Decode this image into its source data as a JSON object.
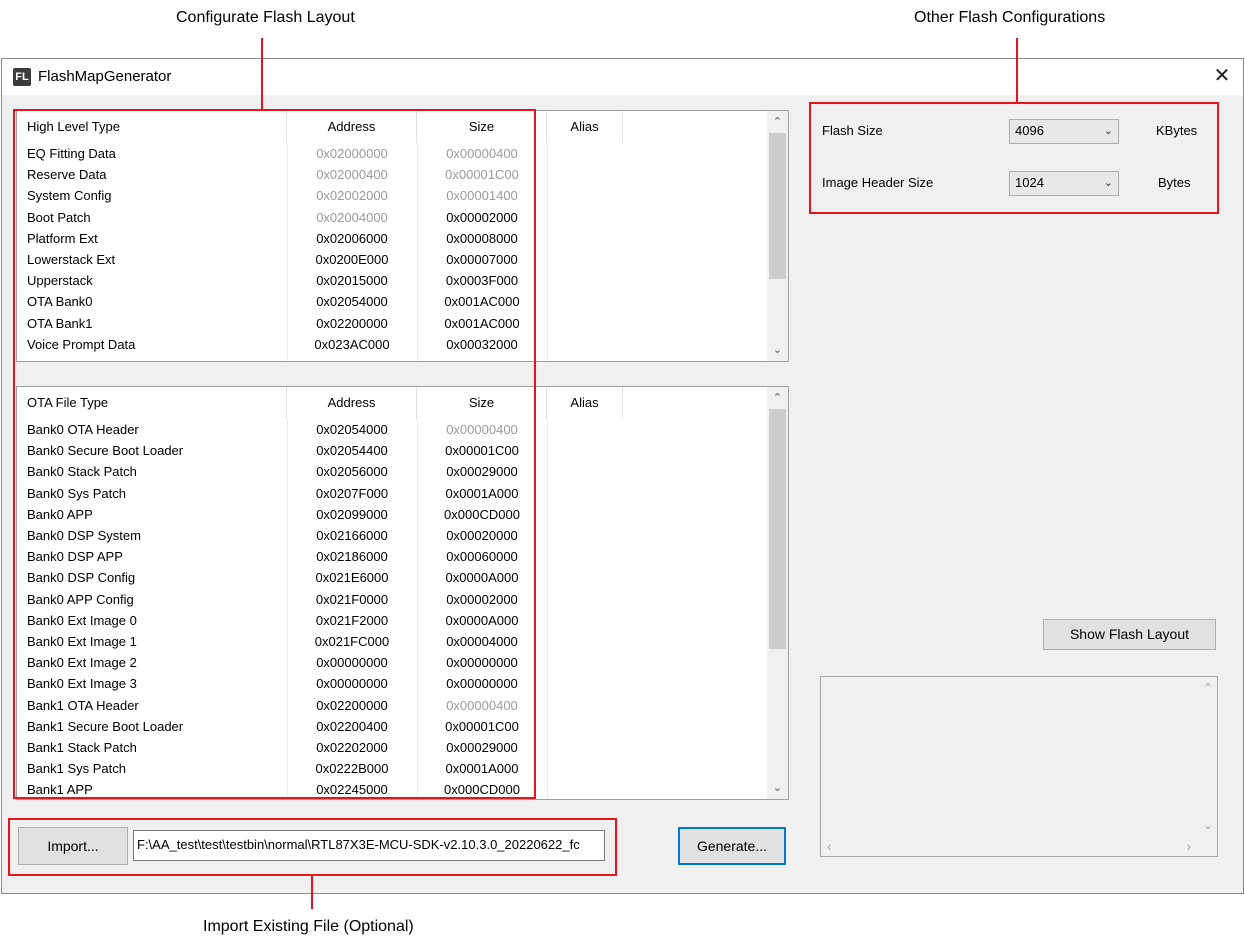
{
  "annotations": {
    "configurate": "Configurate Flash Layout",
    "other": "Other Flash Configurations",
    "import_existing": "Import Existing File (Optional)"
  },
  "window": {
    "title": "FlashMapGenerator",
    "icon_text": "FL",
    "close_glyph": "✕"
  },
  "high_level": {
    "headers": [
      "High Level Type",
      "Address",
      "Size",
      "Alias"
    ],
    "rows": [
      {
        "type": "EQ Fitting Data",
        "address": "0x02000000",
        "size": "0x00000400",
        "addr_gray": true,
        "size_gray": true
      },
      {
        "type": "Reserve Data",
        "address": "0x02000400",
        "size": "0x00001C00",
        "addr_gray": true,
        "size_gray": true
      },
      {
        "type": "System Config",
        "address": "0x02002000",
        "size": "0x00001400",
        "addr_gray": true,
        "size_gray": true
      },
      {
        "type": "Boot Patch",
        "address": "0x02004000",
        "size": "0x00002000",
        "addr_gray": true,
        "size_gray": false
      },
      {
        "type": "Platform Ext",
        "address": "0x02006000",
        "size": "0x00008000",
        "addr_gray": false,
        "size_gray": false
      },
      {
        "type": "Lowerstack Ext",
        "address": "0x0200E000",
        "size": "0x00007000",
        "addr_gray": false,
        "size_gray": false
      },
      {
        "type": "Upperstack",
        "address": "0x02015000",
        "size": "0x0003F000",
        "addr_gray": false,
        "size_gray": false
      },
      {
        "type": "OTA Bank0",
        "address": "0x02054000",
        "size": "0x001AC000",
        "addr_gray": false,
        "size_gray": false
      },
      {
        "type": "OTA Bank1",
        "address": "0x02200000",
        "size": "0x001AC000",
        "addr_gray": false,
        "size_gray": false
      },
      {
        "type": "Voice Prompt Data",
        "address": "0x023AC000",
        "size": "0x00032000",
        "addr_gray": false,
        "size_gray": false
      }
    ]
  },
  "ota_file": {
    "headers": [
      "OTA File Type",
      "Address",
      "Size",
      "Alias"
    ],
    "rows": [
      {
        "type": "Bank0 OTA Header",
        "address": "0x02054000",
        "size": "0x00000400",
        "addr_gray": false,
        "size_gray": true
      },
      {
        "type": "Bank0 Secure Boot Loader",
        "address": "0x02054400",
        "size": "0x00001C00",
        "addr_gray": false,
        "size_gray": false
      },
      {
        "type": "Bank0 Stack Patch",
        "address": "0x02056000",
        "size": "0x00029000",
        "addr_gray": false,
        "size_gray": false
      },
      {
        "type": "Bank0 Sys Patch",
        "address": "0x0207F000",
        "size": "0x0001A000",
        "addr_gray": false,
        "size_gray": false
      },
      {
        "type": "Bank0 APP",
        "address": "0x02099000",
        "size": "0x000CD000",
        "addr_gray": false,
        "size_gray": false
      },
      {
        "type": "Bank0 DSP System",
        "address": "0x02166000",
        "size": "0x00020000",
        "addr_gray": false,
        "size_gray": false
      },
      {
        "type": "Bank0 DSP APP",
        "address": "0x02186000",
        "size": "0x00060000",
        "addr_gray": false,
        "size_gray": false
      },
      {
        "type": "Bank0 DSP Config",
        "address": "0x021E6000",
        "size": "0x0000A000",
        "addr_gray": false,
        "size_gray": false
      },
      {
        "type": "Bank0 APP Config",
        "address": "0x021F0000",
        "size": "0x00002000",
        "addr_gray": false,
        "size_gray": false
      },
      {
        "type": "Bank0 Ext Image 0",
        "address": "0x021F2000",
        "size": "0x0000A000",
        "addr_gray": false,
        "size_gray": false
      },
      {
        "type": "Bank0 Ext Image 1",
        "address": "0x021FC000",
        "size": "0x00004000",
        "addr_gray": false,
        "size_gray": false
      },
      {
        "type": "Bank0 Ext Image 2",
        "address": "0x00000000",
        "size": "0x00000000",
        "addr_gray": false,
        "size_gray": false
      },
      {
        "type": "Bank0 Ext Image 3",
        "address": "0x00000000",
        "size": "0x00000000",
        "addr_gray": false,
        "size_gray": false
      },
      {
        "type": "Bank1 OTA Header",
        "address": "0x02200000",
        "size": "0x00000400",
        "addr_gray": false,
        "size_gray": true
      },
      {
        "type": "Bank1 Secure Boot Loader",
        "address": "0x02200400",
        "size": "0x00001C00",
        "addr_gray": false,
        "size_gray": false
      },
      {
        "type": "Bank1 Stack Patch",
        "address": "0x02202000",
        "size": "0x00029000",
        "addr_gray": false,
        "size_gray": false
      },
      {
        "type": "Bank1 Sys Patch",
        "address": "0x0222B000",
        "size": "0x0001A000",
        "addr_gray": false,
        "size_gray": false
      },
      {
        "type": "Bank1 APP",
        "address": "0x02245000",
        "size": "0x000CD000",
        "addr_gray": false,
        "size_gray": false
      }
    ]
  },
  "config": {
    "flash_size_label": "Flash Size",
    "flash_size_value": "4096",
    "flash_size_unit": "KBytes",
    "image_header_label": "Image Header Size",
    "image_header_value": "1024",
    "image_header_unit": "Bytes"
  },
  "buttons": {
    "show_flash_layout": "Show Flash Layout",
    "import": "Import...",
    "generate": "Generate..."
  },
  "import_path": "F:\\AA_test\\test\\testbin\\normal\\RTL87X3E-MCU-SDK-v2.10.3.0_20220622_fc",
  "icons": {
    "scroll_up": "⌃",
    "scroll_down": "⌄",
    "scroll_left": "‹",
    "scroll_right": "›",
    "combo_chevron": "⌄"
  },
  "colors": {
    "annotation_red": "#e8141c",
    "default_button_border": "#0078d7",
    "gray_text": "#9a9a9a"
  }
}
